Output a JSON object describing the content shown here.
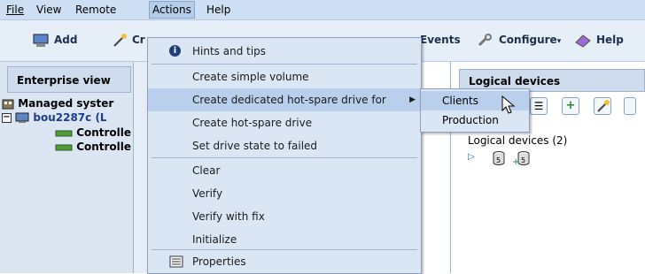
{
  "menubar": {
    "file": "File",
    "view": "View",
    "remote": "Remote",
    "actions": "Actions",
    "help": "Help"
  },
  "toolbar": {
    "add": "Add",
    "create_partial": "Cr",
    "events_partial": "Events",
    "configure": "Configure",
    "help": "Help"
  },
  "enterprise": {
    "header": "Enterprise view",
    "managed": "Managed syster",
    "server": "bou2287c (L",
    "controller1": "Controlle",
    "controller2": "Controlle"
  },
  "logical": {
    "header": "Logical devices",
    "count_label": "Logical devices (2)"
  },
  "actions_menu": {
    "items": [
      "Hints and tips",
      "Create simple volume",
      "Create dedicated hot-spare drive for",
      "Create hot-spare drive",
      "Set drive state to failed",
      "Clear",
      "Verify",
      "Verify with fix",
      "Initialize",
      "Properties"
    ]
  },
  "submenu": {
    "items": [
      "Clients",
      "Production"
    ]
  },
  "colors": {
    "menubar": "#cfdff3",
    "highlight": "#b9cfec",
    "menu_bg": "#dbe6f4"
  }
}
